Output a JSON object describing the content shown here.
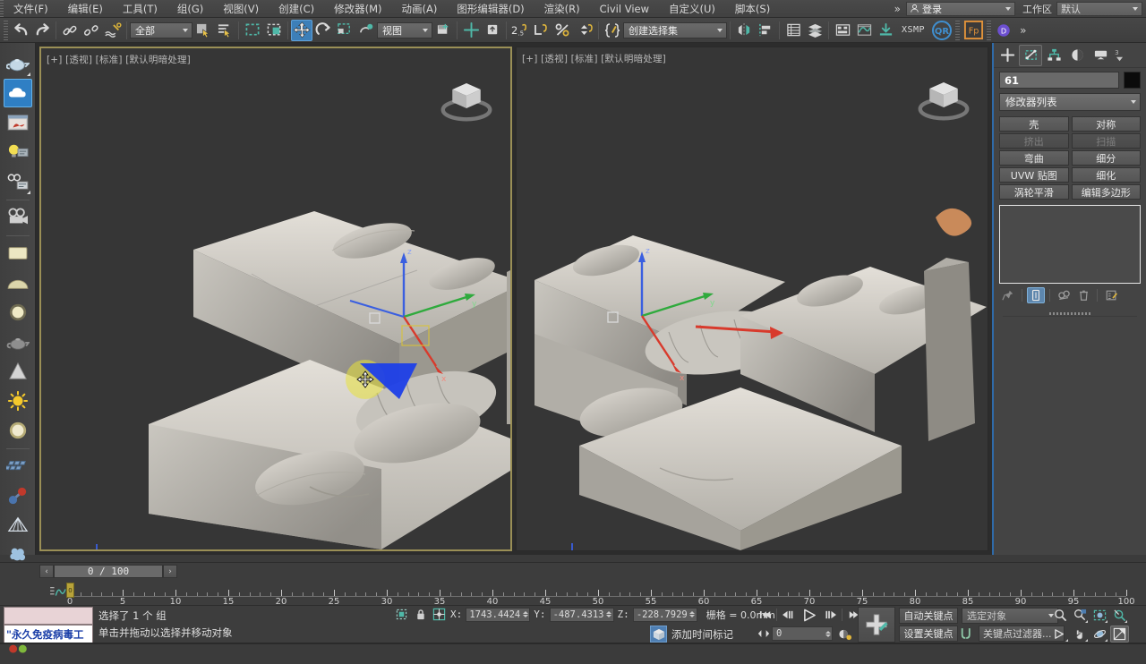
{
  "app": {
    "title": "3ds Max",
    "accent": "#2f6aa8",
    "viewport_bg": "#363636",
    "active_vp_border": "#9a8f56"
  },
  "menubar": {
    "items": [
      {
        "label": "文件(F)",
        "name": "menu-file"
      },
      {
        "label": "编辑(E)",
        "name": "menu-edit"
      },
      {
        "label": "工具(T)",
        "name": "menu-tools"
      },
      {
        "label": "组(G)",
        "name": "menu-group"
      },
      {
        "label": "视图(V)",
        "name": "menu-views"
      },
      {
        "label": "创建(C)",
        "name": "menu-create"
      },
      {
        "label": "修改器(M)",
        "name": "menu-modifiers"
      },
      {
        "label": "动画(A)",
        "name": "menu-animation"
      },
      {
        "label": "图形编辑器(D)",
        "name": "menu-graph-editors"
      },
      {
        "label": "渲染(R)",
        "name": "menu-rendering"
      },
      {
        "label": "Civil View",
        "name": "menu-civil-view"
      },
      {
        "label": "自定义(U)",
        "name": "menu-customize"
      },
      {
        "label": "脚本(S)",
        "name": "menu-scripting"
      }
    ],
    "overflow": "»",
    "login_label": "登录",
    "workspace_label": "工作区",
    "workspace_value": "默认"
  },
  "toolbar": {
    "selection_filter": "全部",
    "ref_coord_system": "视图",
    "named_selection_set": "创建选择集",
    "xsmp_label": "XSMP",
    "buttons": [
      {
        "name": "undo-button",
        "label": "撤消"
      },
      {
        "name": "redo-button",
        "label": "重做"
      },
      {
        "name": "select-and-link-button",
        "label": "选择并链接"
      },
      {
        "name": "unlink-selection-button",
        "label": "断开当前选择链接"
      },
      {
        "name": "bind-to-space-warp-button",
        "label": "绑定到空间扭曲"
      },
      {
        "name": "select-object-button",
        "label": "选择对象"
      },
      {
        "name": "select-by-name-button",
        "label": "按名称选择"
      },
      {
        "name": "rectangular-selection-region-button",
        "label": "矩形选择区域"
      },
      {
        "name": "window-crossing-toggle",
        "label": "窗口/交叉"
      },
      {
        "name": "select-and-move-button",
        "label": "选择并移动"
      },
      {
        "name": "select-and-rotate-button",
        "label": "选择并旋转"
      },
      {
        "name": "select-and-scale-button",
        "label": "选择并均匀缩放"
      },
      {
        "name": "select-and-place-button",
        "label": "选择并放置"
      },
      {
        "name": "use-center-flyout-button",
        "label": "使用轴点中心"
      },
      {
        "name": "select-and-manipulate-button",
        "label": "选择并操纵"
      },
      {
        "name": "snap-toggle-button",
        "label": "捕捉开关 2.5"
      },
      {
        "name": "angle-snap-toggle-button",
        "label": "角度捕捉切换"
      },
      {
        "name": "percent-snap-toggle-button",
        "label": "百分比捕捉切换"
      },
      {
        "name": "spinner-snap-toggle-button",
        "label": "微调器捕捉切换"
      },
      {
        "name": "edit-named-selection-sets-button",
        "label": "编辑命名选择集"
      },
      {
        "name": "mirror-button",
        "label": "镜像"
      },
      {
        "name": "align-flyout-button",
        "label": "对齐"
      },
      {
        "name": "layer-explorer-button",
        "label": "层资源管理器"
      },
      {
        "name": "scene-explorer-button",
        "label": "场景资源管理器"
      },
      {
        "name": "ribbon-toggle-button",
        "label": "切换功能区"
      },
      {
        "name": "curve-editor-button",
        "label": "曲线编辑器"
      },
      {
        "name": "schematic-view-button",
        "label": "图解视图"
      },
      {
        "name": "render-setup-button",
        "label": "渲染设置"
      },
      {
        "name": "qr-button",
        "label": "QR"
      },
      {
        "name": "fp-button",
        "label": "Fp"
      },
      {
        "name": "p-button",
        "label": "P"
      }
    ]
  },
  "left_toolbar": {
    "items": [
      {
        "name": "teapot-tool",
        "label": "茶壶"
      },
      {
        "name": "cloud-tool",
        "label": "云"
      },
      {
        "name": "render-frame-tool",
        "label": "渲染帧窗口"
      },
      {
        "name": "light-tool",
        "label": "灯光"
      },
      {
        "name": "camera-settings-tool",
        "label": "摄影机设置"
      },
      {
        "name": "camera-tool",
        "label": "摄影机"
      },
      {
        "name": "plane-material-tool",
        "label": "平面材质"
      },
      {
        "name": "dome-material-tool",
        "label": "球顶材质"
      },
      {
        "name": "sphere-material-tool",
        "label": "球体材质"
      },
      {
        "name": "teapot-material-tool",
        "label": "茶壶材质"
      },
      {
        "name": "cone-material-tool",
        "label": "圆锥材质"
      },
      {
        "name": "sun-tool",
        "label": "太阳光"
      },
      {
        "name": "skylight-tool",
        "label": "天光"
      },
      {
        "name": "proxy-array-tool",
        "label": "代理阵列"
      },
      {
        "name": "molecule-tool",
        "label": "分子"
      },
      {
        "name": "wire-pyramid-tool",
        "label": "线框金字塔"
      },
      {
        "name": "scatter-tool",
        "label": "散布"
      },
      {
        "name": "grass-tool",
        "label": "草"
      },
      {
        "name": "sphere-preview-tool",
        "label": "球体预览"
      },
      {
        "name": "color-dots-tool",
        "label": "颜色"
      }
    ]
  },
  "viewports": [
    {
      "name": "viewport-perspective-left",
      "label": "[+] [透视] [标准] [默认明暗处理]",
      "active": true
    },
    {
      "name": "viewport-perspective-right",
      "label": "[+] [透视] [标准] [默认明暗处理]",
      "active": false
    }
  ],
  "command_panel": {
    "tabs": [
      {
        "name": "tab-create",
        "label": "创建",
        "icon": "plus-icon",
        "active": false
      },
      {
        "name": "tab-modify",
        "label": "修改",
        "icon": "modify-icon",
        "active": true
      },
      {
        "name": "tab-hierarchy",
        "label": "层次",
        "icon": "hierarchy-icon",
        "active": false
      },
      {
        "name": "tab-motion",
        "label": "运动",
        "icon": "motion-icon",
        "active": false
      },
      {
        "name": "tab-display",
        "label": "显示",
        "icon": "display-icon",
        "active": false
      },
      {
        "name": "tab-utilities",
        "label": "工具",
        "icon": "utilities-icon",
        "active": false
      }
    ],
    "object_name": "61",
    "object_color": "#0b0b0b",
    "modifier_list_label": "修改器列表",
    "modifier_buttons": [
      {
        "label": "壳",
        "name": "modifier-shell-button",
        "disabled": false
      },
      {
        "label": "对称",
        "name": "modifier-symmetry-button",
        "disabled": false
      },
      {
        "label": "挤出",
        "name": "modifier-extrude-button",
        "disabled": true
      },
      {
        "label": "扫描",
        "name": "modifier-sweep-button",
        "disabled": true
      },
      {
        "label": "弯曲",
        "name": "modifier-bend-button",
        "disabled": false
      },
      {
        "label": "细分",
        "name": "modifier-subdivide-button",
        "disabled": false
      },
      {
        "label": "UVW 贴图",
        "name": "modifier-uvw-map-button",
        "disabled": false
      },
      {
        "label": "细化",
        "name": "modifier-tessellate-button",
        "disabled": false
      },
      {
        "label": "涡轮平滑",
        "name": "modifier-turbosmooth-button",
        "disabled": false
      },
      {
        "label": "编辑多边形",
        "name": "modifier-edit-poly-button",
        "disabled": false
      }
    ],
    "stack_tools": [
      {
        "name": "pin-stack-button",
        "label": "固定堆栈",
        "active": false
      },
      {
        "name": "show-end-result-button",
        "label": "显示最终结果",
        "active": true
      },
      {
        "name": "make-unique-button",
        "label": "使唯一",
        "active": false
      },
      {
        "name": "remove-modifier-button",
        "label": "从堆栈中移除修改器",
        "active": false
      },
      {
        "name": "configure-modifier-sets-button",
        "label": "配置修改器集",
        "active": false
      }
    ]
  },
  "timebar": {
    "frame_field": "0 / 100",
    "prev_label": "‹",
    "next_label": "›",
    "current_frame": 0,
    "range_start": 0,
    "range_end": 100,
    "tick_step": 5,
    "tick_labels": [
      0,
      5,
      10,
      15,
      20,
      25,
      30,
      35,
      40,
      45,
      50,
      55,
      60,
      65,
      70,
      75,
      80,
      85,
      90,
      95,
      100
    ]
  },
  "statusbar": {
    "listener_text": "",
    "prompt_text": "\"永久免疫病毒工",
    "status_line_1": "选择了 1 个 组",
    "status_line_2": "单击并拖动以选择并移动对象",
    "coords": {
      "x_label": "X:",
      "x_value": "1743.4424",
      "y_label": "Y:",
      "y_value": "-487.4313",
      "z_label": "Z:",
      "z_value": "-228.7929",
      "grid_label": "栅格 = 0.0mm"
    },
    "add_time_tag": "添加时间标记",
    "selection_lock_name": "selection-lock-toggle",
    "current_frame_value": "0",
    "auto_key_label": "自动关键点",
    "set_key_label": "设置关键点",
    "key_filters_label": "关键点过滤器...",
    "key_mode_value": "选定对象",
    "playback_buttons": [
      {
        "name": "go-to-start-button",
        "label": "转至开头"
      },
      {
        "name": "previous-frame-button",
        "label": "上一帧"
      },
      {
        "name": "play-animation-button",
        "label": "播放动画"
      },
      {
        "name": "next-frame-button",
        "label": "下一帧"
      },
      {
        "name": "go-to-end-button",
        "label": "转至结尾"
      }
    ],
    "nav_buttons": [
      {
        "name": "zoom-button",
        "label": "缩放"
      },
      {
        "name": "zoom-all-button",
        "label": "缩放所有视图"
      },
      {
        "name": "zoom-extents-button",
        "label": "最大化显示"
      },
      {
        "name": "zoom-region-button",
        "label": "视野"
      },
      {
        "name": "pan-orbit-button",
        "label": "环绕"
      },
      {
        "name": "pan-view-button",
        "label": "平移视图"
      },
      {
        "name": "orbit-button",
        "label": "环绕子对象"
      },
      {
        "name": "maximize-viewport-button",
        "label": "最大化视口切换"
      }
    ]
  }
}
